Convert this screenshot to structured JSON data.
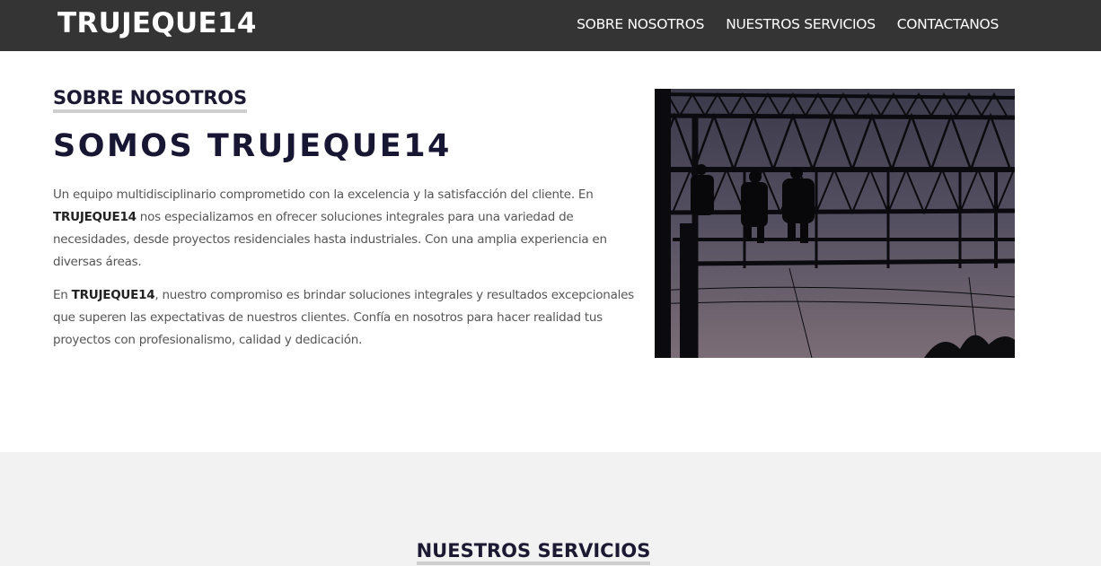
{
  "navbar": {
    "brand": "TRUJEQUE14",
    "links": [
      {
        "label": "SOBRE NOSOTROS"
      },
      {
        "label": "NUESTROS SERVICIOS"
      },
      {
        "label": "CONTACTANOS"
      }
    ]
  },
  "about": {
    "eyebrow": "SOBRE NOSOTROS",
    "headline": "SOMOS TRUJEQUE14",
    "p1": {
      "before": "Un equipo multidisciplinario comprometido con la excelencia y la satisfacción del cliente. En ",
      "bold": "TRUJEQUE14",
      "after": " nos especializamos en ofrecer soluciones integrales para una variedad de necesidades, desde proyectos residenciales hasta industriales. Con una amplia experiencia en diversas áreas."
    },
    "p2": {
      "before": "En ",
      "bold": "TRUJEQUE14",
      "after": ", nuestro compromiso es brindar soluciones integrales y resultados excepcionales que superen las expectativas de nuestros clientes. Confía en nosotros para hacer realidad tus proyectos con profesionalismo, calidad y dedicación."
    }
  },
  "services": {
    "title": "NUESTROS SERVICIOS"
  },
  "colors": {
    "navbar_bg": "#343434",
    "heading": "#171633",
    "services_bg": "#f2f2f2",
    "underline": "#cfcfcf"
  }
}
